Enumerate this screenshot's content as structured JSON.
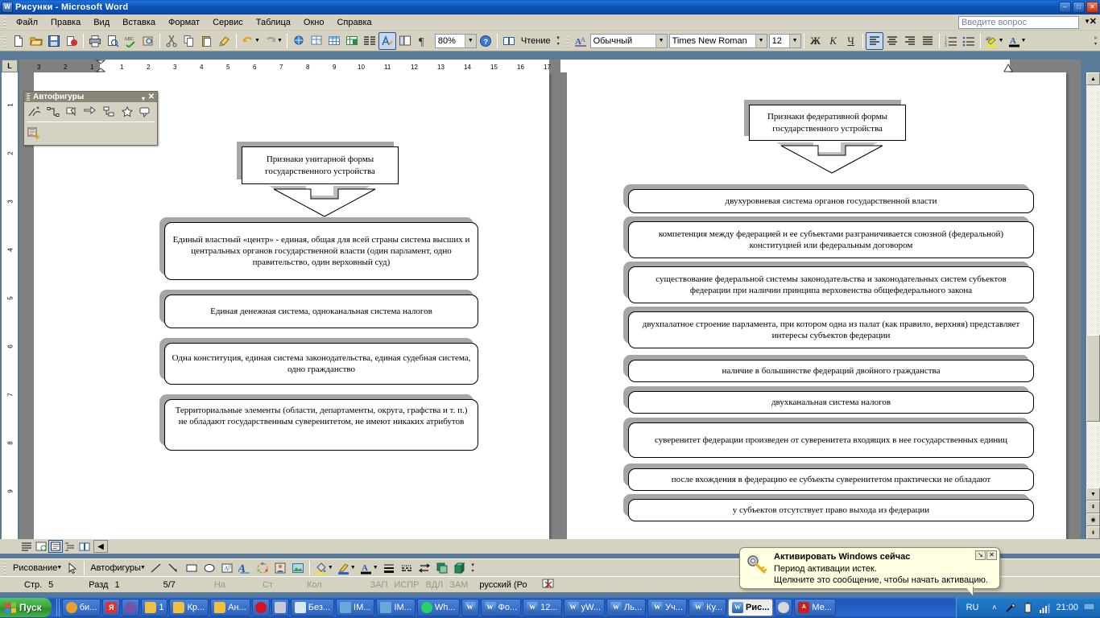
{
  "window": {
    "title": "Рисунки - Microsoft Word",
    "minimize": "–",
    "maximize": "□",
    "close": "✕"
  },
  "menu": {
    "items": [
      "Файл",
      "Правка",
      "Вид",
      "Вставка",
      "Формат",
      "Сервис",
      "Таблица",
      "Окно",
      "Справка"
    ],
    "ask_placeholder": "Введите вопрос"
  },
  "toolbar": {
    "zoom_value": "80%",
    "reading_label": "Чтение",
    "style_value": "Обычный",
    "font_value": "Times New Roman",
    "size_value": "12",
    "bold": "Ж",
    "italic": "К",
    "underline": "Ч",
    "icons": [
      "new-document-icon",
      "open-folder-icon",
      "save-icon",
      "email-icon",
      "print-icon",
      "print-preview-icon",
      "spellcheck-icon",
      "research-icon",
      "cut-icon",
      "copy-icon",
      "paste-icon",
      "format-painter-icon",
      "undo-icon",
      "redo-icon",
      "hyperlink-icon",
      "tables-borders-icon",
      "insert-table-icon",
      "insert-excel-icon",
      "columns-icon",
      "drawing-icon",
      "document-map-icon",
      "show-formatting-icon"
    ]
  },
  "autoshapes_palette": {
    "title": "Автофигуры",
    "collapse_icon": "▾",
    "close_icon": "✕",
    "buttons": [
      "lines-autoshape-icon",
      "connectors-autoshape-icon",
      "basic-shapes-autoshape-icon",
      "block-arrows-autoshape-icon",
      "flowchart-autoshape-icon",
      "stars-banners-autoshape-icon",
      "callouts-autoshape-icon",
      "more-autoshapes-icon"
    ]
  },
  "ruler": {
    "h_ticks": [
      "3",
      "2",
      "1",
      "1",
      "2",
      "3",
      "4",
      "5",
      "6",
      "7",
      "8",
      "9",
      "10",
      "11",
      "12",
      "13",
      "14",
      "15",
      "16",
      "17"
    ],
    "v_ticks": [
      "1",
      "2",
      "3",
      "4",
      "5",
      "6",
      "7",
      "8",
      "9"
    ]
  },
  "document": {
    "left_page": {
      "header": "Признаки унитарной формы государственного устройства",
      "items": [
        "Единый властный «центр» - единая, общая для всей страны система высших и центральных органов государственной власти (один парламент, одно правительство, один верховный суд)",
        "Единая денежная система, одноканальная система налогов",
        "Одна конституция, единая система законодательства, единая судебная система, одно гражданство",
        "Территориальные элементы (области, департаменты, округа, графства и т. п.) не обладают государственным суверенитетом, не имеют никаких атрибутов"
      ]
    },
    "right_page": {
      "header": "Признаки федеративной формы государственного устройства",
      "items": [
        "двухуровневая система органов государственной власти",
        "компетенция между федерацией и ее субъектами разграничивается союзной (федеральной) конституцией или федеральным договором",
        "существование федеральной системы законодательства и законодательных систем субъектов федерации при наличии принципа верховенства общефедерального закона",
        "двухпалатное строение парламента, при котором одна из палат (как правило, верхняя) представляет интересы субъектов федерации",
        "наличие в большинстве федераций двойного гражданства",
        "двухканальная система налогов",
        "суверенитет федерации произведен от суверенитета входящих в нее государственных единиц",
        "после вхождения в федерацию ее субъекты суверенитетом практически не обладают",
        "у субъектов отсутствует право выхода из федерации"
      ]
    }
  },
  "drawing_toolbar": {
    "draw_label": "Рисование",
    "autoshapes_label": "Автофигуры",
    "icons": [
      "select-objects-icon",
      "line-icon",
      "arrow-icon",
      "rectangle-icon",
      "oval-icon",
      "text-box-icon",
      "wordart-icon",
      "diagram-icon",
      "clipart-icon",
      "picture-icon",
      "fill-color-icon",
      "line-color-icon",
      "font-color-icon",
      "line-style-icon",
      "dash-style-icon",
      "arrow-style-icon",
      "shadow-style-icon",
      "3d-style-icon"
    ]
  },
  "status_bar": {
    "page_label": "Стр.",
    "page_value": "5",
    "section_label": "Разд",
    "section_value": "1",
    "pages": "5/7",
    "at_label": "На",
    "line_label": "Ст",
    "col_label": "Кол",
    "rec": "ЗАП",
    "trk": "ИСПР",
    "ext": "ВДЛ",
    "ovr": "ЗАМ",
    "language": "русский (Ро",
    "spell_icon": "spellcheck-status-icon"
  },
  "balloon": {
    "title": "Активировать Windows сейчас",
    "line1": "Период активации истек.",
    "line2": "Щелкните это сообщение, чтобы начать активацию.",
    "minimize_icon": "↘",
    "close_icon": "✕",
    "key_icon": "key-icon"
  },
  "taskbar": {
    "start": "Пуск",
    "items": [
      {
        "label": "би...",
        "icon": "chrome-icon",
        "color": "#e8a030",
        "active": false
      },
      {
        "label": "",
        "icon": "yandex-icon",
        "color": "#e03030",
        "active": false
      },
      {
        "label": "",
        "icon": "viber-icon",
        "color": "#7b51a8",
        "active": false
      },
      {
        "label": "1",
        "icon": "folder-icon",
        "color": "#f0c040",
        "active": false
      },
      {
        "label": "Кр...",
        "icon": "folder-icon",
        "color": "#f0c040",
        "active": false
      },
      {
        "label": "Ан...",
        "icon": "folder-icon",
        "color": "#f0c040",
        "active": false
      },
      {
        "label": "",
        "icon": "opera-icon",
        "color": "#d81020",
        "active": false
      },
      {
        "label": "",
        "icon": "calculator-icon",
        "color": "#c8c8d8",
        "active": false
      },
      {
        "label": "Без...",
        "icon": "notepad-icon",
        "color": "#d8e8f8",
        "active": false
      },
      {
        "label": "IM...",
        "icon": "image-icon",
        "color": "#68a8d8",
        "active": false
      },
      {
        "label": "IM...",
        "icon": "image-icon",
        "color": "#68a8d8",
        "active": false
      },
      {
        "label": "Wh...",
        "icon": "whatsapp-icon",
        "color": "#25d366",
        "active": false
      },
      {
        "label": "",
        "icon": "word-icon",
        "color": "#2a5fa8",
        "active": false
      },
      {
        "label": "Фо...",
        "icon": "word-icon",
        "color": "#2a5fa8",
        "active": false
      },
      {
        "label": "12...",
        "icon": "word-icon",
        "color": "#2a5fa8",
        "active": false
      },
      {
        "label": "yW...",
        "icon": "word-icon",
        "color": "#2a5fa8",
        "active": false
      },
      {
        "label": "Ль...",
        "icon": "word-icon",
        "color": "#2a5fa8",
        "active": false
      },
      {
        "label": "Уч...",
        "icon": "word-icon",
        "color": "#2a5fa8",
        "active": false
      },
      {
        "label": "Ку...",
        "icon": "word-icon",
        "color": "#2a5fa8",
        "active": false
      },
      {
        "label": "Рис...",
        "icon": "word-icon",
        "color": "#2a5fa8",
        "active": true
      },
      {
        "label": "",
        "icon": "yandex-browser-icon",
        "color": "#d8d8d8",
        "active": false
      },
      {
        "label": "Ме...",
        "icon": "pdf-icon",
        "color": "#c82020",
        "active": false
      }
    ],
    "language": "RU",
    "clock": "21:00",
    "tray_icons": [
      "show-hidden-icons",
      "safely-remove-icon",
      "battery-icon",
      "network-icon",
      "desktop-icon"
    ]
  },
  "colors": {
    "titlebar": "#0b55b8",
    "chrome": "#d6d2c2",
    "page": "#ffffff",
    "shadow": "#a6a6a6",
    "taskbar": "#2a63c8",
    "balloon": "#ffffe1"
  }
}
